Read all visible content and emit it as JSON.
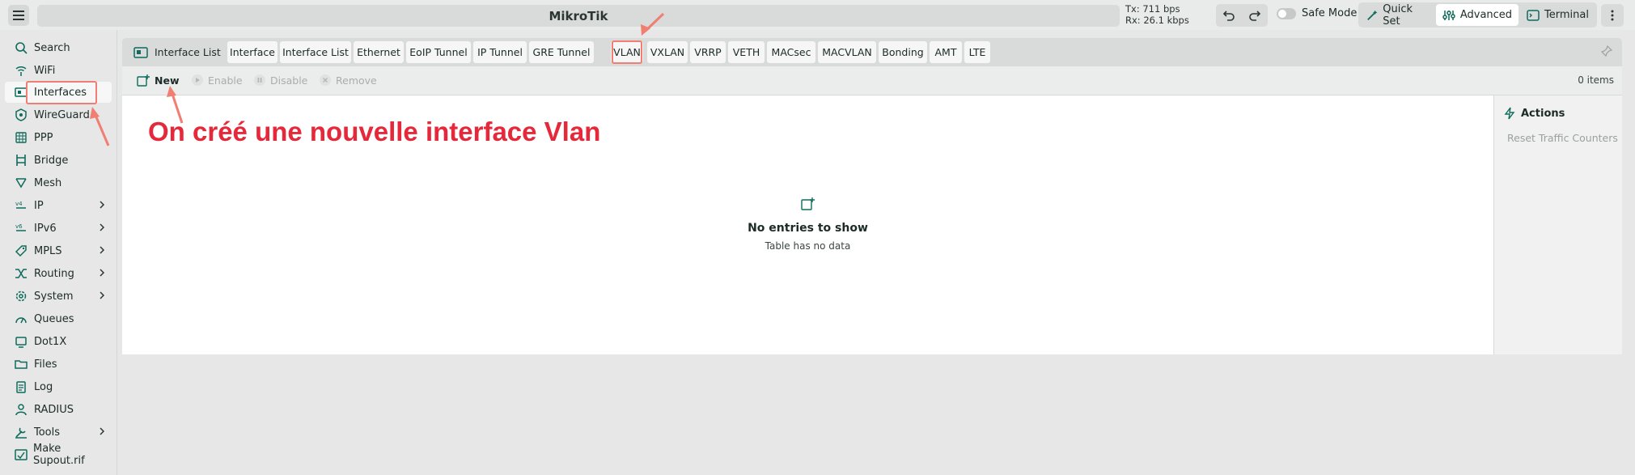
{
  "app": {
    "title": "MikroTik"
  },
  "traffic": {
    "tx": "Tx: 711 bps",
    "rx": "Rx: 26.1 kbps"
  },
  "topbar": {
    "safe_mode": "Safe Mode",
    "quick_set": "Quick Set",
    "advanced": "Advanced",
    "terminal": "Terminal"
  },
  "sidebar": {
    "items": [
      {
        "label": "Search",
        "icon": "search-icon"
      },
      {
        "label": "WiFi",
        "icon": "wifi-icon"
      },
      {
        "label": "Interfaces",
        "icon": "interfaces-icon"
      },
      {
        "label": "WireGuard",
        "icon": "wireguard-icon"
      },
      {
        "label": "PPP",
        "icon": "ppp-icon"
      },
      {
        "label": "Bridge",
        "icon": "bridge-icon"
      },
      {
        "label": "Mesh",
        "icon": "mesh-icon"
      },
      {
        "label": "IP",
        "icon": "ip-icon"
      },
      {
        "label": "IPv6",
        "icon": "ipv6-icon"
      },
      {
        "label": "MPLS",
        "icon": "mpls-icon"
      },
      {
        "label": "Routing",
        "icon": "routing-icon"
      },
      {
        "label": "System",
        "icon": "system-icon"
      },
      {
        "label": "Queues",
        "icon": "queues-icon"
      },
      {
        "label": "Dot1X",
        "icon": "dot1x-icon"
      },
      {
        "label": "Files",
        "icon": "files-icon"
      },
      {
        "label": "Log",
        "icon": "log-icon"
      },
      {
        "label": "RADIUS",
        "icon": "radius-icon"
      },
      {
        "label": "Tools",
        "icon": "tools-icon"
      },
      {
        "label": "Make Supout.rif",
        "icon": "supout-icon"
      }
    ]
  },
  "tabs": {
    "lead": "Interface List",
    "items": [
      "Interface",
      "Interface List",
      "Ethernet",
      "EoIP Tunnel",
      "IP Tunnel",
      "GRE Tunnel",
      "VLAN",
      "VXLAN",
      "VRRP",
      "VETH",
      "MACsec",
      "MACVLAN",
      "Bonding",
      "AMT",
      "LTE"
    ]
  },
  "toolbar": {
    "new": "New",
    "enable": "Enable",
    "disable": "Disable",
    "remove": "Remove",
    "count": "0 items"
  },
  "table": {
    "empty_title": "No entries to show",
    "empty_sub": "Table has no data"
  },
  "actions": {
    "title": "Actions",
    "reset": "Reset Traffic Counters"
  },
  "annotation": {
    "text": "On créé une nouvelle interface Vlan",
    "color": "#e5283a",
    "box_color": "#f07e72"
  }
}
